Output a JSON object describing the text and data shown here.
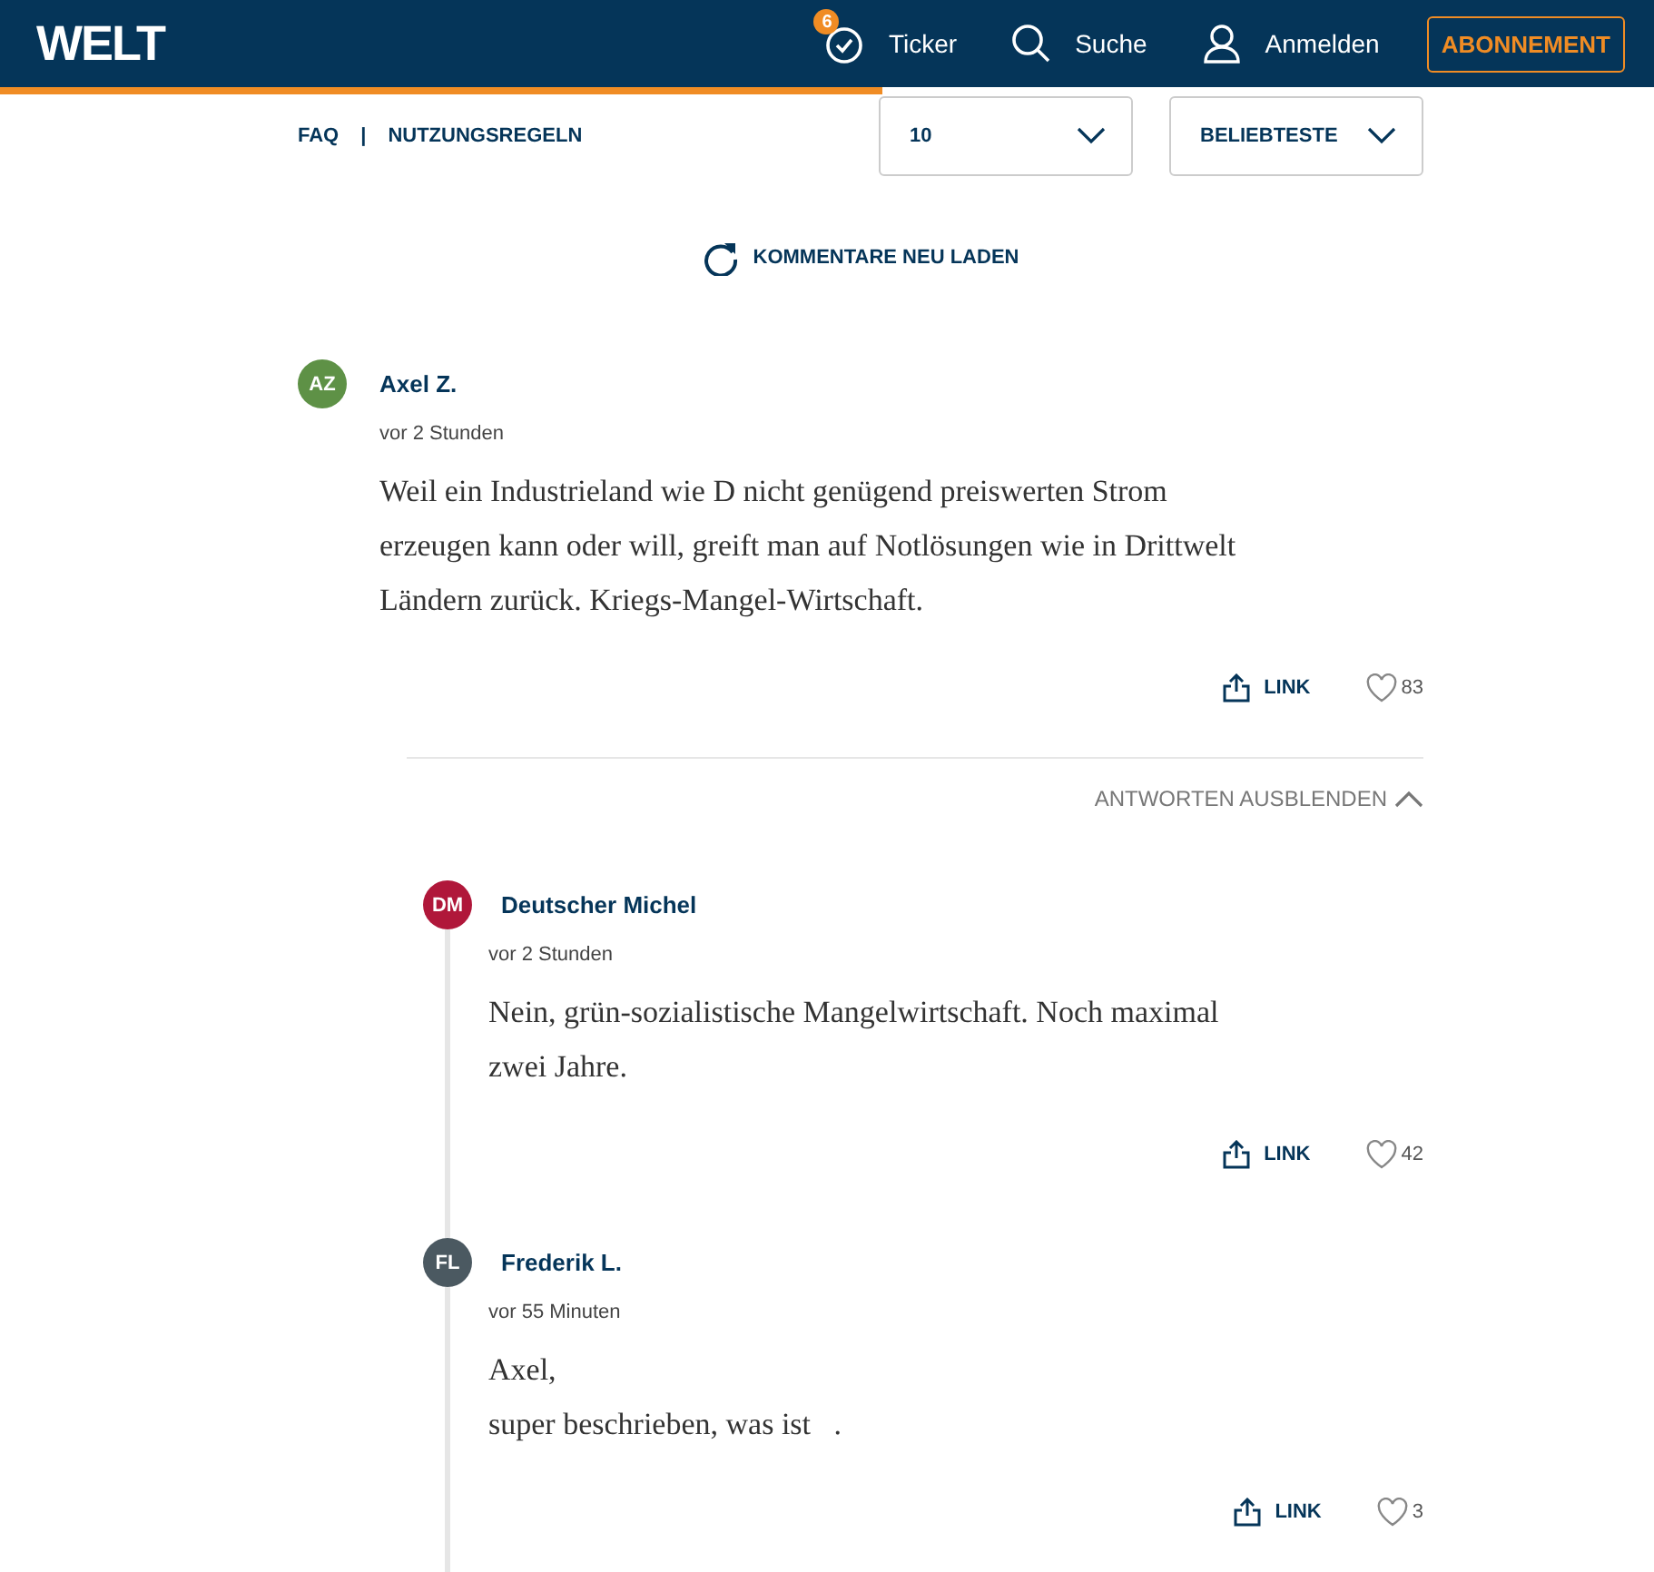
{
  "header": {
    "logo": "WELT",
    "ticker": {
      "badge": "6",
      "label": "Ticker"
    },
    "search": "Suche",
    "login": "Anmelden",
    "subscribe": "ABONNEMENT",
    "reading_progress": {
      "level": 0.533
    }
  },
  "toolbar": {
    "links": [
      "FAQ",
      "NUTZUNGSREGELN"
    ],
    "separator": "|",
    "page_size": "10",
    "sort": "BELIEBTESTE"
  },
  "reload": "KOMMENTARE NEU LADEN",
  "comments": [
    {
      "initials": "AZ",
      "color": "#5e9146",
      "author": "Axel Z.",
      "time": "vor 2 Stunden",
      "text": "Weil ein Industrieland wie D nicht genügend preiswerten Strom erzeugen kann oder will, greift man auf Notlösungen wie in Drittwelt Ländern zurück. Kriegs-Mangel-Wirtschaft.",
      "link": "LINK",
      "likes": "83",
      "replies_toggle": "ANTWORTEN AUSBLENDEN",
      "expanded": true,
      "replies": [
        {
          "initials": "DM",
          "color": "#b0173a",
          "author": "Deutscher Michel",
          "time": "vor 2 Stunden",
          "text": "Nein, grün-sozialistische Mangelwirtschaft. Noch maximal zwei Jahre.",
          "link": "LINK",
          "likes": "42"
        },
        {
          "initials": "FL",
          "color": "#4b5961",
          "author": "Frederik L.",
          "time": "vor 55 Minuten",
          "text": "Axel,\nsuper beschrieben, was ist   .",
          "link": "LINK",
          "likes": "3"
        }
      ]
    }
  ]
}
